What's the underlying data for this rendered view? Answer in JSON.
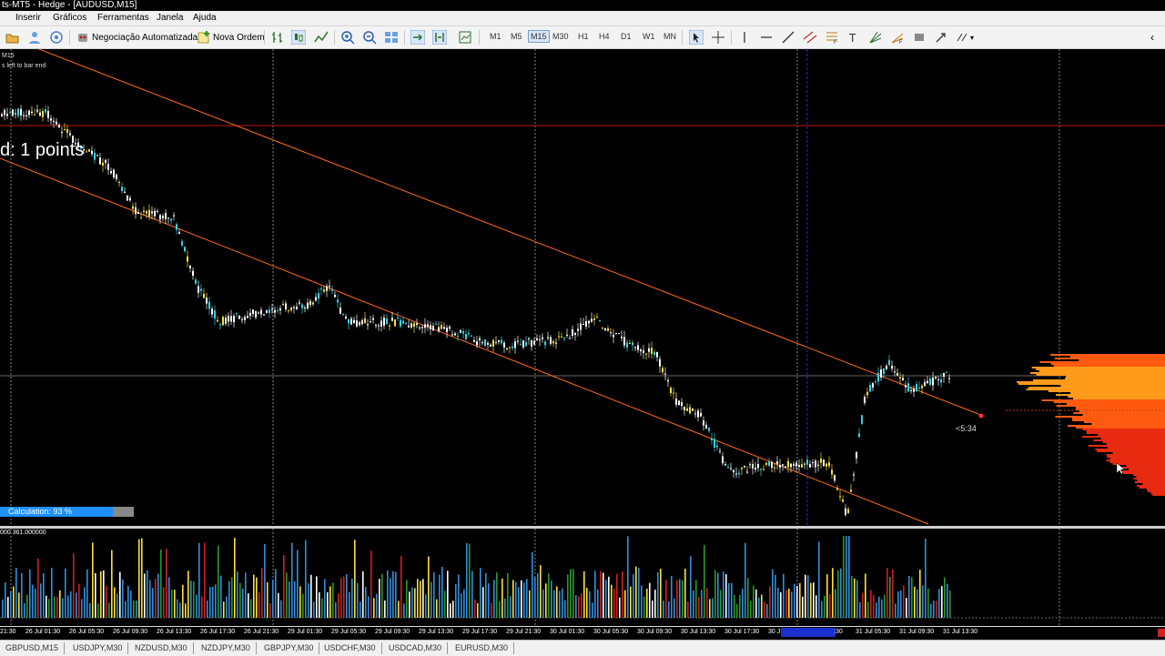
{
  "window": {
    "title": "ts-MT5 - Hedge - [AUDUSD,M15]"
  },
  "menu": [
    "Inserir",
    "Gráficos",
    "Ferramentas",
    "Janela",
    "Ajuda"
  ],
  "toolbar": {
    "algo_trading": "Negociação Automatizada",
    "new_order": "Nova Ordem",
    "timeframes": [
      "M1",
      "M5",
      "M15",
      "M30",
      "H1",
      "H4",
      "D1",
      "W1",
      "MN"
    ],
    "active_timeframe": "M15"
  },
  "chart": {
    "top_left_label": "M15",
    "bar_timer_label": "s left to bar end",
    "spread_label": "d: 1 points",
    "calculation_label": "Calculation: 93 %",
    "calculation_progress": 0.93,
    "countdown": "<5:34",
    "volume_label": "000 361.000000",
    "colors": {
      "channel": "#ff6a1a",
      "resistance": "#c01010",
      "bull": "#ffffff",
      "bear_cyan": "#33d6e8",
      "yellow": "#ffe033",
      "vol_blue": "#2f8fdc"
    }
  },
  "time_axis": [
    "21:30",
    "26 Jul 01:30",
    "26 Jul 05:30",
    "26 Jul 09:30",
    "26 Jul 13:30",
    "26 Jul 17:30",
    "26 Jul 21:30",
    "29 Jul 01:30",
    "29 Jul 05:30",
    "29 Jul 09:30",
    "29 Jul 13:30",
    "29 Jul 17:30",
    "29 Jul 21:30",
    "30 Jul 01:30",
    "30 Jul 05:30",
    "30 Jul 09:30",
    "30 Jul 13:30",
    "30 Jul 17:30",
    "30 J",
    ":30",
    "31 Jul 05:30",
    "31 Jul 09:30",
    "31 Jul 13:30"
  ],
  "tabs": [
    "GBPUSD,M15",
    "USDJPY,M30",
    "NZDUSD,M30",
    "NZDJPY,M30",
    "GBPJPY,M30",
    "USDCHF,M30",
    "USDCAD,M30",
    "EURUSD,M30"
  ]
}
